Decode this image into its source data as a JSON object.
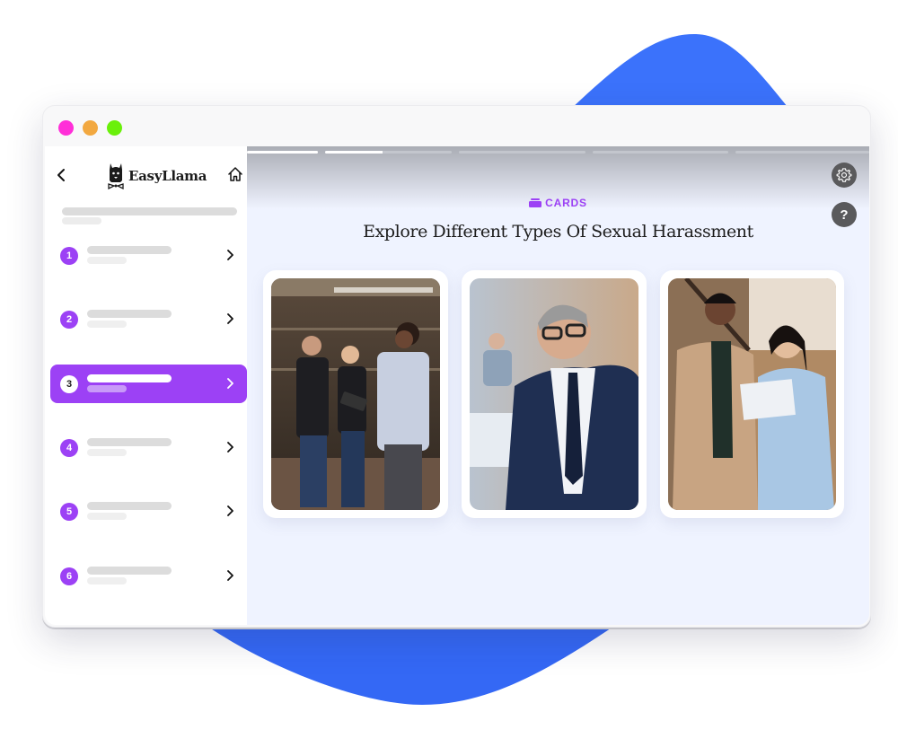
{
  "window": {
    "traffic_lights": [
      {
        "name": "close",
        "color": "#ff2fd8"
      },
      {
        "name": "minimize",
        "color": "#f2a840"
      },
      {
        "name": "maximize",
        "color": "#6af00b"
      }
    ]
  },
  "sidebar": {
    "brand": "EasyLlama",
    "back_icon": "chevron-left-icon",
    "home_icon": "home-icon",
    "chapters": [
      {
        "number": "1",
        "active": false
      },
      {
        "number": "2",
        "active": false
      },
      {
        "number": "3",
        "active": true
      },
      {
        "number": "4",
        "active": false
      },
      {
        "number": "5",
        "active": false
      },
      {
        "number": "6",
        "active": false
      }
    ]
  },
  "main": {
    "progress_segments": [
      1.0,
      0.45,
      0,
      0,
      0
    ],
    "kicker": "CARDS",
    "title": "Explore Different Types Of Sexual Harassment",
    "settings_icon": "gear-icon",
    "help_label": "?",
    "cards": [
      {
        "image": "team-meeting-in-restaurant"
      },
      {
        "image": "businessman-in-office"
      },
      {
        "image": "coworkers-reviewing-document"
      }
    ]
  },
  "colors": {
    "accent": "#9c41f5",
    "blob": "#3b72fb",
    "main_bg": "#eff3ff"
  }
}
